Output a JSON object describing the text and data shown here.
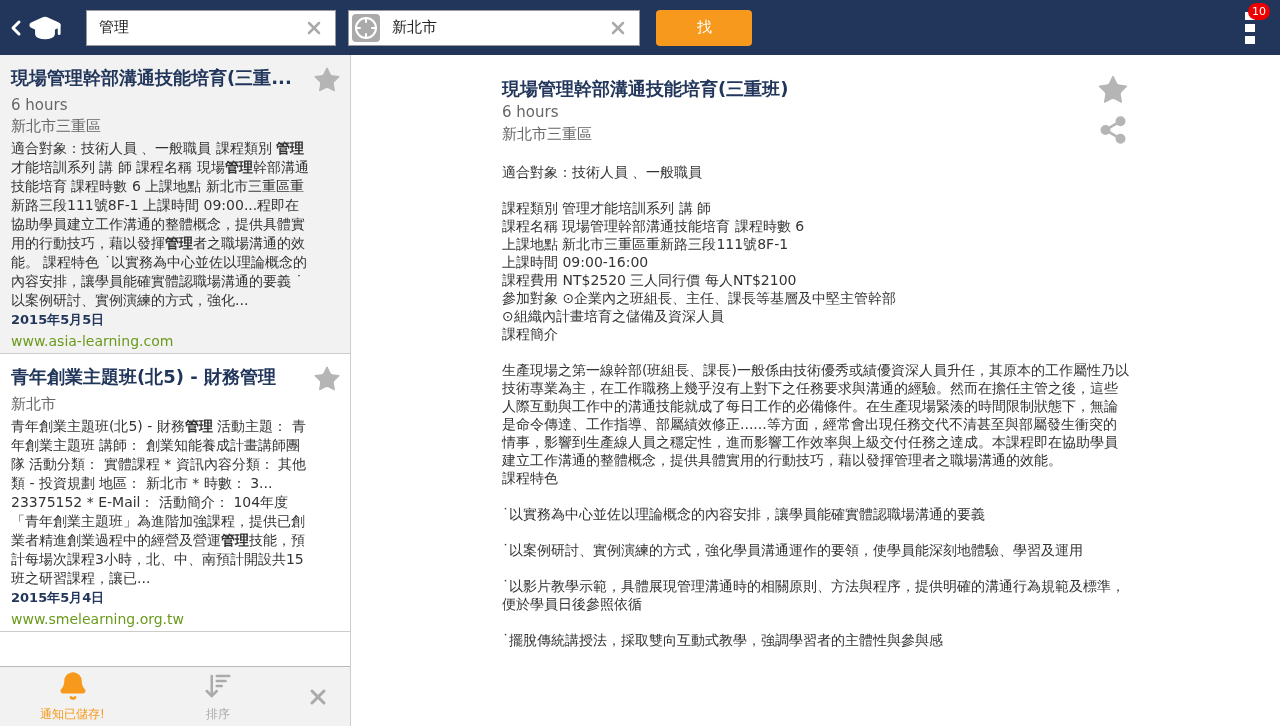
{
  "search": {
    "value": "管理"
  },
  "location": {
    "value": "新北市"
  },
  "search_button": {
    "label": "找"
  },
  "menu": {
    "badge": "10"
  },
  "results": [
    {
      "title": "現場管理幹部溝通技能培育(三重...",
      "starred": false,
      "selected": true,
      "meta": [
        "6 hours",
        "新北市三重區"
      ],
      "snippet": "適合對象：技術人員 、一般職員 課程類別 **管理**才能培訓系列 講 師 課程名稱 現場**管理**幹部溝通技能培育 課程時數 6 上課地點 新北市三重區重新路三段111號8F-1 上課時間 09:00...程即在協助學員建立工作溝通的整體概念，提供具體實用的行動技巧，藉以發揮**管理**者之職場溝通的效能。 課程特色 ˙以實務為中心並佐以理論概念的內容安排，讓學員能確實體認職場溝通的要義 ˙以案例研討、實例演練的方式，強化...",
      "date": "2015年5月5日",
      "url": "www.asia-learning.com"
    },
    {
      "title": "青年創業主題班(北5) - 財務管理",
      "starred": false,
      "selected": false,
      "meta": [
        "新北市"
      ],
      "snippet": "青年創業主題班(北5) - 財務**管理** 活動主題： 青年創業主題班 講師： 創業知能養成計畫講師團隊 活動分類： 實體課程 * 資訊內容分類： 其他類 - 投資規劃 地區： 新北市 * 時數： 3... 23375152 * E-Mail： 活動簡介： 104年度「青年創業主題班」為進階加強課程，提供已創業者精進創業過程中的經營及營運**管理**技能，預計每場次課程3小時，北、中、南預計開設共15班之研習課程，讓已...",
      "date": "2015年5月4日",
      "url": "www.smelearning.org.tw"
    }
  ],
  "bottom_bar": [
    {
      "kind": "bell",
      "label": "通知已儲存!",
      "active": true
    },
    {
      "kind": "sort",
      "label": "排序",
      "active": false
    },
    {
      "kind": "close"
    }
  ],
  "detail": {
    "title": "現場管理幹部溝通技能培育(三重班)",
    "starred": false,
    "meta": [
      "6 hours",
      "新北市三重區"
    ],
    "blocks": [
      [
        "適合對象：技術人員 、一般職員"
      ],
      [
        "課程類別 管理才能培訓系列 講 師",
        "課程名稱 現場管理幹部溝通技能培育 課程時數 6",
        "上課地點 新北市三重區重新路三段111號8F-1",
        "上課時間 09:00-16:00",
        "課程費用 NT$2520 三人同行價 每人NT$2100",
        "參加對象 ⊙企業內之班組長、主任、課長等基層及中堅主管幹部",
        "⊙組織內計畫培育之儲備及資深人員",
        "課程簡介"
      ],
      [
        "生產現場之第一線幹部(班組長、課長)一般係由技術優秀或績優資深人員升任，其原本的工作屬性乃以技術專業為主，在工作職務上幾乎沒有上對下之任務要求與溝通的經驗。然而在擔任主管之後，這些人際互動與工作中的溝通技能就成了每日工作的必備條件。在生產現場緊湊的時間限制狀態下，無論是命令傳達、工作指導、部屬績效修正......等方面，經常會出現任務交代不清甚至與部屬發生衝突的情事，影響到生產線人員之穩定性，進而影響工作效率與上級交付任務之達成。本課程即在協助學員建立工作溝通的整體概念，提供具體實用的行動技巧，藉以發揮管理者之職場溝通的效能。",
        "課程特色"
      ],
      [
        "˙以實務為中心並佐以理論概念的內容安排，讓學員能確實體認職場溝通的要義"
      ],
      [
        "˙以案例研討、實例演練的方式，強化學員溝通運作的要領，使學員能深刻地體驗、學習及運用"
      ],
      [
        "˙以影片教學示範，具體展現管理溝通時的相關原則、方法與程序，提供明確的溝通行為規範及標準，便於學員日後參照依循"
      ],
      [
        "˙擺脫傳統講授法，採取雙向互動式教學，強調學習者的主體性與參與感"
      ]
    ]
  }
}
